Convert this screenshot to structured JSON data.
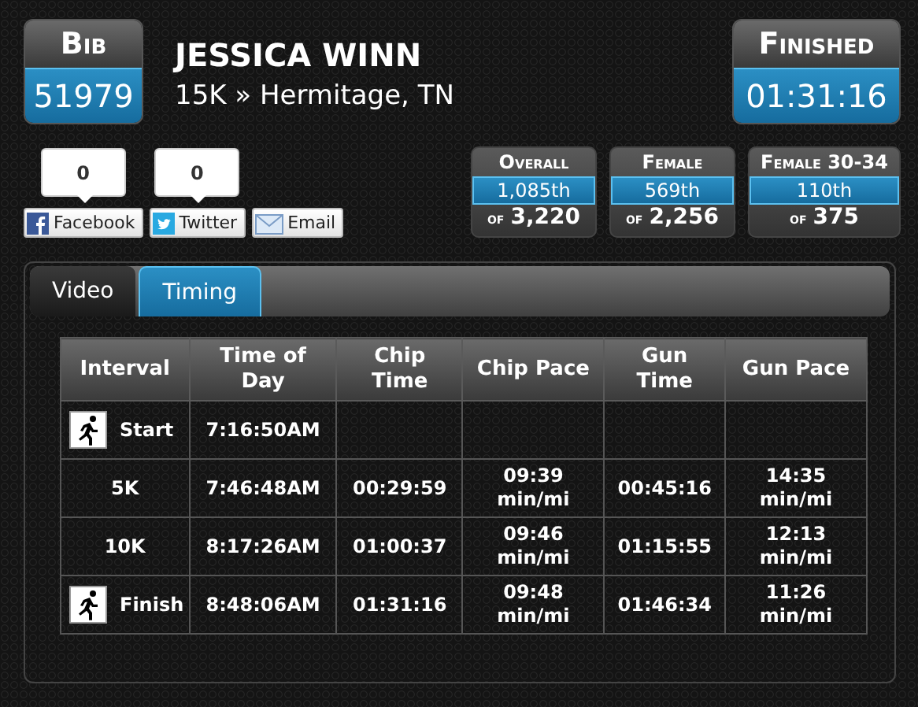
{
  "bib": {
    "label": "Bib",
    "value": "51979"
  },
  "runner": {
    "name": "JESSICA WINN",
    "race": "15K » Hermitage, TN"
  },
  "finished": {
    "label": "Finished",
    "value": "01:31:16"
  },
  "social": [
    {
      "kind": "facebook",
      "count": "0",
      "label": "Facebook"
    },
    {
      "kind": "twitter",
      "count": "0",
      "label": "Twitter"
    },
    {
      "kind": "email",
      "label": "Email"
    }
  ],
  "ranks": [
    {
      "label": "Overall",
      "place": "1,085th",
      "of": "of",
      "total": "3,220"
    },
    {
      "label": "Female",
      "place": "569th",
      "of": "of",
      "total": "2,256"
    },
    {
      "label": "Female 30-34",
      "place": "110th",
      "of": "of",
      "total": "375"
    }
  ],
  "tabs": [
    {
      "label": "Video",
      "selected": false
    },
    {
      "label": "Timing",
      "selected": true
    }
  ],
  "table": {
    "columns": [
      "Interval",
      "Time of Day",
      "Chip Time",
      "Chip Pace",
      "Gun Time",
      "Gun Pace"
    ],
    "rows": [
      {
        "kind": "marker",
        "cells": [
          "Start",
          "7:16:50AM",
          "",
          "",
          "",
          ""
        ]
      },
      {
        "kind": "split",
        "cells": [
          "5K",
          "7:46:48AM",
          "00:29:59",
          "09:39 min/mi",
          "00:45:16",
          "14:35 min/mi"
        ]
      },
      {
        "kind": "split",
        "cells": [
          "10K",
          "8:17:26AM",
          "01:00:37",
          "09:46 min/mi",
          "01:15:55",
          "12:13 min/mi"
        ]
      },
      {
        "kind": "marker",
        "cells": [
          "Finish",
          "8:48:06AM",
          "01:31:16",
          "09:48 min/mi",
          "01:46:34",
          "11:26 min/mi"
        ]
      }
    ]
  }
}
